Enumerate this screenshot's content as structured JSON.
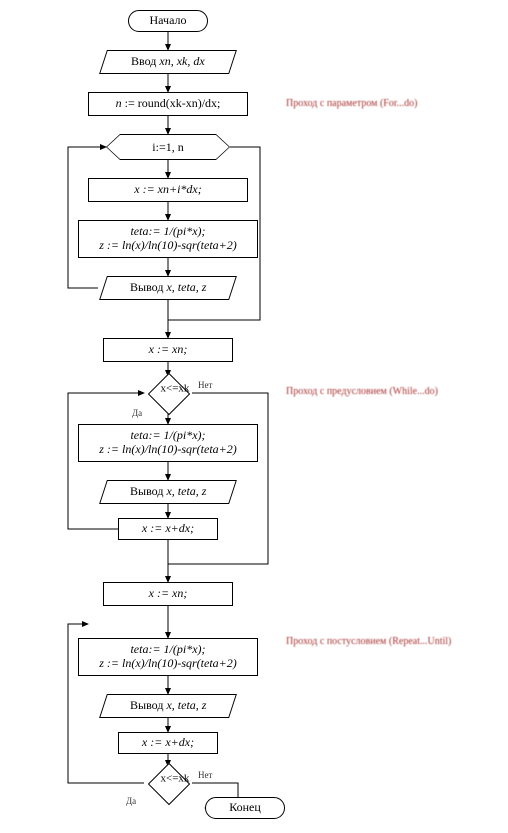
{
  "chart_data": {
    "type": "flowchart",
    "title": "",
    "nodes": [
      {
        "id": "start",
        "kind": "terminator",
        "text": "Начало"
      },
      {
        "id": "input",
        "kind": "io",
        "text": "Ввод xn, xk, dx"
      },
      {
        "id": "n_calc",
        "kind": "process",
        "text": "n := round(xk-xn)/dx;"
      },
      {
        "id": "for_loop",
        "kind": "loop",
        "text": "i:=1, n"
      },
      {
        "id": "x_for",
        "kind": "process",
        "text": "x := xn+i*dx;"
      },
      {
        "id": "calc_for",
        "kind": "process",
        "text": "teta:= 1/(pi*x);\nz := ln(x)/ln(10)-sqr(teta+2)"
      },
      {
        "id": "out_for",
        "kind": "io",
        "text": "Вывод x, teta, z"
      },
      {
        "id": "x_while_init",
        "kind": "process",
        "text": "x := xn;"
      },
      {
        "id": "while_cond",
        "kind": "decision",
        "text": "x<=xk"
      },
      {
        "id": "calc_while",
        "kind": "process",
        "text": "teta:= 1/(pi*x);\nz := ln(x)/ln(10)-sqr(teta+2)"
      },
      {
        "id": "out_while",
        "kind": "io",
        "text": "Вывод x, teta, z"
      },
      {
        "id": "x_while_step",
        "kind": "process",
        "text": "x := x+dx;"
      },
      {
        "id": "x_repeat_init",
        "kind": "process",
        "text": "x := xn;"
      },
      {
        "id": "calc_repeat",
        "kind": "process",
        "text": "teta:= 1/(pi*x);\nz := ln(x)/ln(10)-sqr(teta+2)"
      },
      {
        "id": "out_repeat",
        "kind": "io",
        "text": "Вывод x, teta, z"
      },
      {
        "id": "x_repeat_step",
        "kind": "process",
        "text": "x := x+dx;"
      },
      {
        "id": "repeat_cond",
        "kind": "decision",
        "text": "x<=xk"
      },
      {
        "id": "end",
        "kind": "terminator",
        "text": "Конец"
      }
    ],
    "annotations": [
      "Проход с параметром (For...do)",
      "Проход с предусловием (While...do)",
      "Проход с постусловием (Repeat...Until)"
    ]
  },
  "labels": {
    "start": "Начало",
    "input": "Ввод ",
    "input_vars": "xn, xk, dx",
    "n_assign_left": "n",
    "n_assign_right": " := round(xk-xn)/dx;",
    "loop_hdr": "i:=1, n",
    "x_for_line": "x := xn+i*dx;",
    "calc_l1": "teta:= 1/(pi*x);",
    "calc_l2": "z := ln(x)/ln(10)-sqr(teta+2)",
    "out_prefix": "Вывод ",
    "out_vars": "x, teta, z",
    "x_init": "x := xn;",
    "cond": "x<=xk",
    "x_step": "x := x+dx;",
    "end": "Конец",
    "anno1": "Проход с параметром (For...do)",
    "anno2": "Проход с предусловием (While...do)",
    "anno3": "Проход с постусловием (Repeat...Until)",
    "yes": "Да",
    "no": "Нет"
  }
}
